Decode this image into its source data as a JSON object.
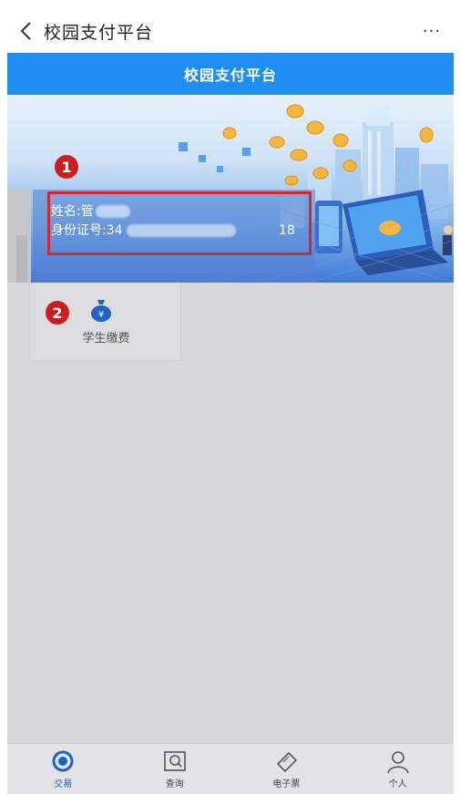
{
  "app": {
    "title": "校园支付平台",
    "more_label": "···"
  },
  "header": {
    "title": "校园支付平台"
  },
  "user_info": {
    "name_label": "姓名:管",
    "id_label": "身份证号:34",
    "id_suffix": "18"
  },
  "badges": [
    "1",
    "2"
  ],
  "services": [
    {
      "label": "学生缴费",
      "icon": "money-bag-icon"
    }
  ],
  "tabs": [
    {
      "label": "交易",
      "icon": "transaction-icon",
      "active": true
    },
    {
      "label": "查询",
      "icon": "search-icon",
      "active": false
    },
    {
      "label": "电子票",
      "icon": "ticket-icon",
      "active": false
    },
    {
      "label": "个人",
      "icon": "person-icon",
      "active": false
    }
  ],
  "colors": {
    "brand_blue": "#1f8df2",
    "highlight_red": "#d6262d",
    "active_tab": "#1b63c9"
  }
}
